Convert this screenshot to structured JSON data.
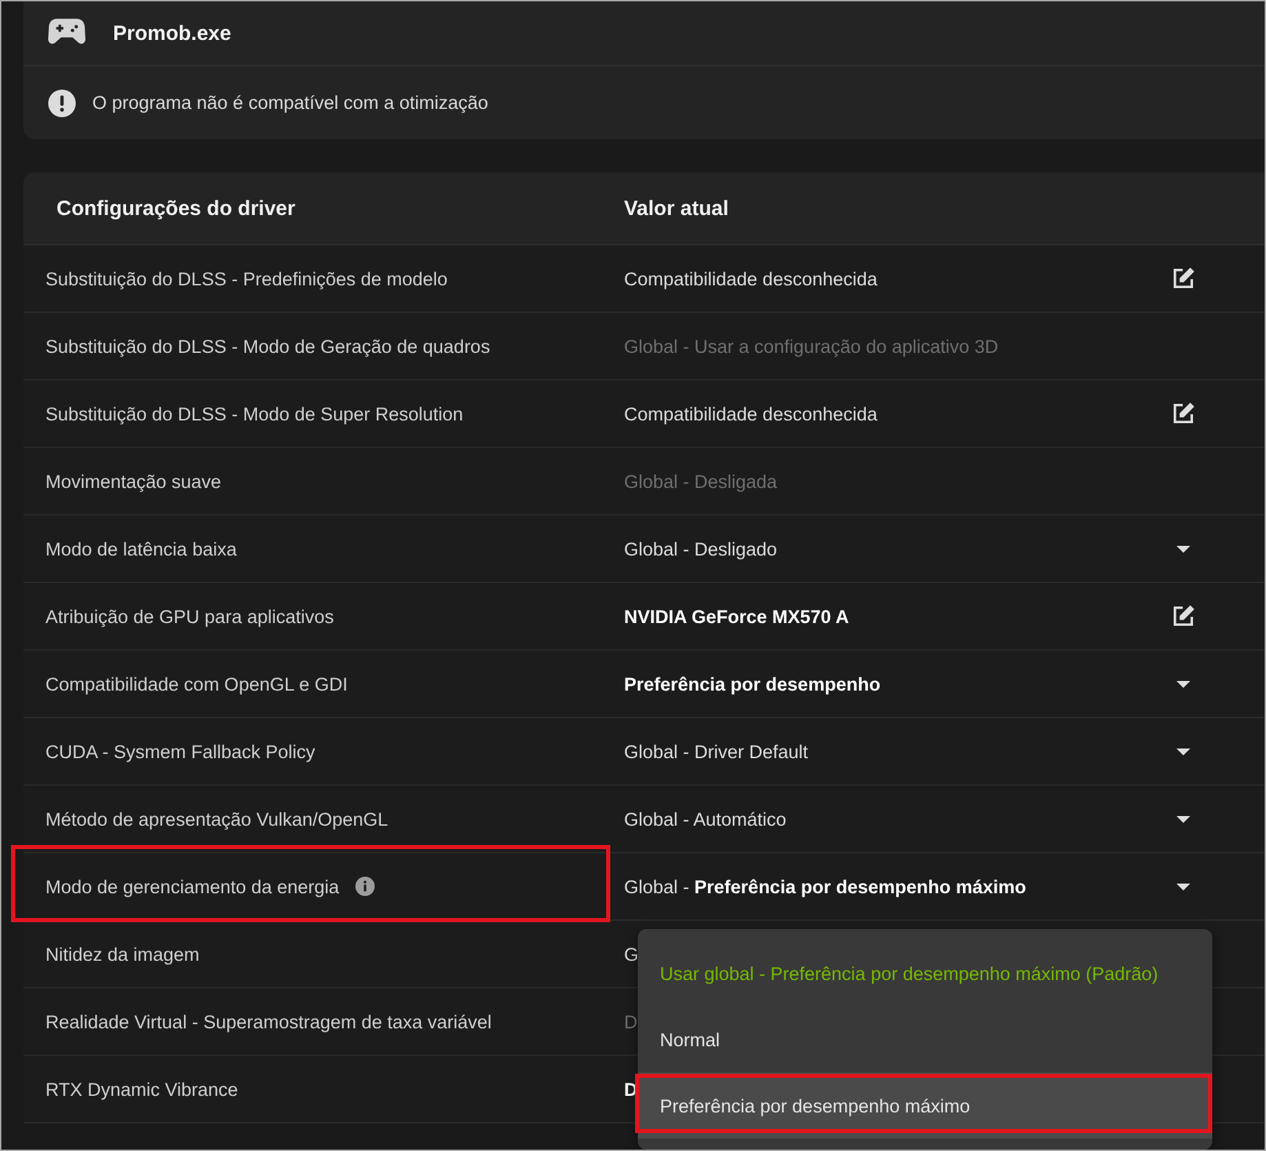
{
  "app": {
    "name": "Promob.exe",
    "warning": "O programa não é compatível com a otimização"
  },
  "settings_table": {
    "columns": [
      "Configurações do driver",
      "Valor atual"
    ],
    "rows": [
      {
        "setting": "Substituição do DLSS - Predefinições de modelo",
        "value": "Compatibilidade desconhecida",
        "kind": "edit",
        "disabled": false,
        "overridden": false,
        "info": false,
        "highlighted": false
      },
      {
        "setting": "Substituição do DLSS - Modo de Geração de quadros",
        "value": "Global - Usar a configuração do aplicativo 3D",
        "kind": "plain",
        "disabled": true,
        "overridden": false,
        "info": false,
        "highlighted": false
      },
      {
        "setting": "Substituição do DLSS - Modo de Super Resolution",
        "value": "Compatibilidade desconhecida",
        "kind": "edit",
        "disabled": false,
        "overridden": false,
        "info": false,
        "highlighted": false
      },
      {
        "setting": "Movimentação suave",
        "value": "Global - Desligada",
        "kind": "plain",
        "disabled": true,
        "overridden": false,
        "info": false,
        "highlighted": false
      },
      {
        "setting": "Modo de latência baixa",
        "value": "Global - Desligado",
        "kind": "dropdown",
        "disabled": false,
        "overridden": false,
        "info": false,
        "highlighted": false
      },
      {
        "setting": "Atribuição de GPU para aplicativos",
        "value": "NVIDIA GeForce MX570 A",
        "kind": "edit",
        "disabled": false,
        "overridden": true,
        "info": false,
        "highlighted": false
      },
      {
        "setting": "Compatibilidade com OpenGL e GDI",
        "value": "Preferência por desempenho",
        "kind": "dropdown",
        "disabled": false,
        "overridden": true,
        "info": false,
        "highlighted": false
      },
      {
        "setting": "CUDA - Sysmem Fallback Policy",
        "value": "Global - Driver Default",
        "kind": "dropdown",
        "disabled": false,
        "overridden": false,
        "info": false,
        "highlighted": false
      },
      {
        "setting": "Método de apresentação Vulkan/OpenGL",
        "value": "Global - Automático",
        "kind": "dropdown",
        "disabled": false,
        "overridden": false,
        "info": false,
        "highlighted": false
      },
      {
        "setting": "Modo de gerenciamento da energia",
        "value": "Global - **Preferência por desempenho máximo**",
        "kind": "dropdown",
        "disabled": false,
        "overridden": false,
        "info": true,
        "highlighted": true,
        "menu": {
          "options": [
            {
              "label": "Usar global - Preferência por desempenho máximo (Padrão)",
              "selected": true,
              "hovered": false,
              "highlighted": false
            },
            {
              "label": "Normal",
              "selected": false,
              "hovered": false,
              "highlighted": false
            },
            {
              "label": "Preferência por desempenho máximo",
              "selected": false,
              "hovered": true,
              "highlighted": true
            }
          ]
        }
      },
      {
        "setting": "Nitidez da imagem",
        "value": "G",
        "kind": "plain",
        "disabled": false,
        "overridden": false,
        "info": false,
        "highlighted": false
      },
      {
        "setting": "Realidade Virtual - Superamostragem de taxa variável",
        "value": "D",
        "kind": "plain",
        "disabled": true,
        "overridden": false,
        "info": false,
        "highlighted": false
      },
      {
        "setting": "RTX Dynamic Vibrance",
        "value": "D",
        "kind": "plain",
        "disabled": false,
        "overridden": true,
        "info": false,
        "highlighted": false
      }
    ]
  }
}
